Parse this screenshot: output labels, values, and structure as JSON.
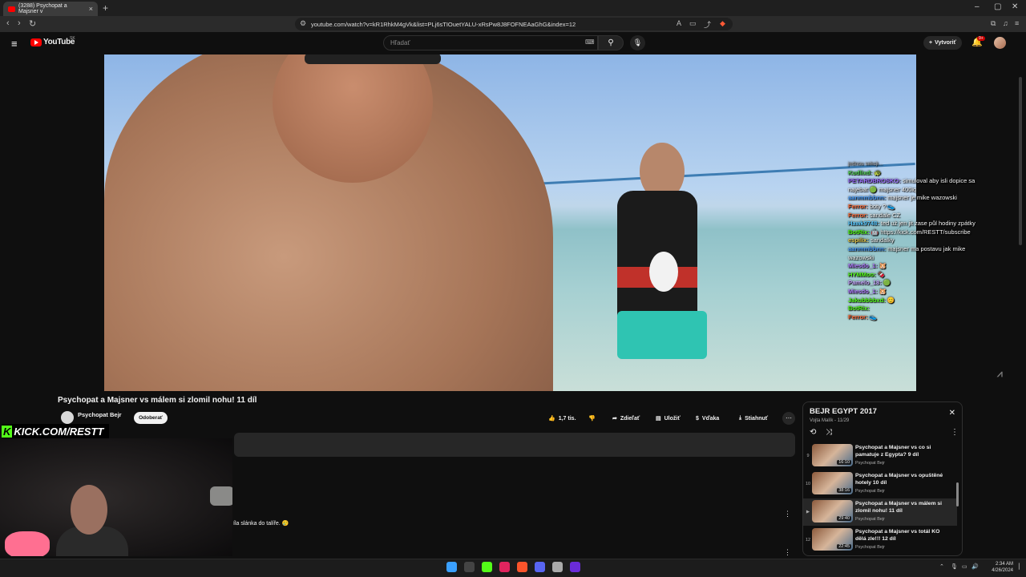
{
  "browser": {
    "tab_title": "(3288) Psychopat a Majsner v",
    "tab_close": "×",
    "new_tab": "+",
    "url": "youtube.com/watch?v=kR1RhkM4gVk&list=PLj6sTIOuetYALU-xRsPw8J8FOFNEAaGhG&index=12"
  },
  "youtube": {
    "logo_text": "YouTube",
    "region": "SK",
    "search_placeholder": "Hľadať",
    "create_label": "Vytvoriť",
    "notif_count": "9+"
  },
  "chat": {
    "header": "jednou sekcji...",
    "messages": [
      {
        "user": "Kudlixd:",
        "text": "🐢",
        "color": "#4fd14f"
      },
      {
        "user": "PETARDBROSKO:",
        "text": "simuloval aby isli dopice sa najebat 🟢 majsner 400iq",
        "color": "#9b6cff"
      },
      {
        "user": "aanmmbbnn:",
        "text": "majsner je mike wazowski",
        "color": "#4fa3ff"
      },
      {
        "user": "Ferror:",
        "text": "boty ? 👟",
        "color": "#ff6d3a"
      },
      {
        "user": "Ferror:",
        "text": "sandale CZ",
        "color": "#ff6d3a"
      },
      {
        "user": "Hawk9748:",
        "text": "ted už jen jit zase půl hodiny zpátky",
        "color": "#58c8ff"
      },
      {
        "user": "BotRix:",
        "text": "🤖 https://kick.com/RESTT/subscribe",
        "color": "#53fc18"
      },
      {
        "user": "espilix:",
        "text": "sandalky",
        "color": "#e6c84a"
      },
      {
        "user": "aanmmbbnn:",
        "text": "majsner ma postavu jak mike wazowski",
        "color": "#4fa3ff"
      },
      {
        "user": "Miesdo_1:",
        "text": "🐹",
        "color": "#b07cff"
      },
      {
        "user": "HYMMoo:",
        "text": "🍫",
        "color": "#53fc18"
      },
      {
        "user": "Pamelo_18:",
        "text": "🟢",
        "color": "#c7a7ff"
      },
      {
        "user": "Miesdo_1:",
        "text": "🐹",
        "color": "#b07cff"
      },
      {
        "user": "Jakubbbbxd:",
        "text": "😊",
        "color": "#53fc18"
      },
      {
        "user": "BotRix:",
        "text": "",
        "color": "#53fc18"
      },
      {
        "user": "Ferror:",
        "text": "👟",
        "color": "#ff6d3a"
      }
    ]
  },
  "video": {
    "title": "Psychopat a Majsner vs málem si zlomil nohu! 11 díl",
    "channel": "Psychopat Bejr",
    "unsubscribe_label": "Odoberať",
    "likes": "1,7 tis.",
    "share_label": "Zdieľať",
    "save_label": "Uložiť",
    "thanks_label": "Vďaka",
    "download_label": "Stiahnuť",
    "comment_snippet": "íla slánka do talíře. 🥲"
  },
  "overlay": {
    "kick_k": "K",
    "kick_text": "KICK.COM/RESTT"
  },
  "playlist": {
    "title": "BEJR EGYPT 2017",
    "subtitle": "Vojta Malík - 11/29",
    "items": [
      {
        "index": "9",
        "title": "Psychopat a Majsner vs co si pamatuje z Egypta? 9 díl",
        "channel": "Psychopat Bejr",
        "duration": "16:10",
        "active": false
      },
      {
        "index": "10",
        "title": "Psychopat a Majsner vs opuštěné hotely 10 díl",
        "channel": "Psychopat Bejr",
        "duration": "38:16",
        "active": false
      },
      {
        "index": "▶",
        "title": "Psychopat a Majsner vs málem si zlomil nohu! 11 díl",
        "channel": "Psychopat Bejr",
        "duration": "29:40",
        "active": true
      },
      {
        "index": "12",
        "title": "Psychopat a Majsner vs totál KO dělá zle!!! 12 díl",
        "channel": "Psychopat Bejr",
        "duration": "22:45",
        "active": false
      }
    ]
  },
  "taskbar": {
    "time": "2:34 AM",
    "date": "4/26/2024"
  }
}
